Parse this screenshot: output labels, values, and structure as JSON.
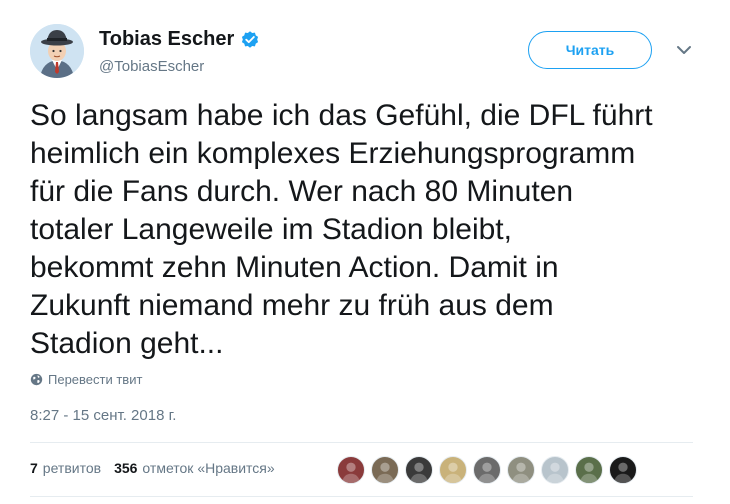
{
  "user": {
    "display_name": "Tobias Escher",
    "handle": "@TobiasEscher",
    "verified_icon": "verified-badge-icon",
    "avatar_icon": "avatar-man-with-hat"
  },
  "follow_button": {
    "label": "Читать"
  },
  "menu_caret_icon": "chevron-down-icon",
  "tweet": {
    "text": "So langsam habe ich das Gefühl, die DFL führt\nheimlich ein komplexes Erziehungsprogramm\nfür die Fans durch. Wer nach 80 Minuten\ntotaler Langeweile im Stadion bleibt,\nbekommt zehn Minuten Action. Damit in\nZukunft niemand mehr zu früh aus dem\nStadion geht..."
  },
  "translate": {
    "label": "Перевести твит",
    "icon": "globe-icon"
  },
  "timestamp": "8:27 - 15 сент. 2018 г.",
  "stats": {
    "retweets_count": "7",
    "retweets_label": "ретвитов",
    "likes_count": "356",
    "likes_label": "отметок «Нравится»"
  },
  "likers": [
    {
      "icon": "liker-avatar-1",
      "color": "#8a3b3b"
    },
    {
      "icon": "liker-avatar-2",
      "color": "#7a6a55"
    },
    {
      "icon": "liker-avatar-3",
      "color": "#3a3a3a"
    },
    {
      "icon": "liker-avatar-4",
      "color": "#c9b27a"
    },
    {
      "icon": "liker-avatar-5",
      "color": "#6b6b6b"
    },
    {
      "icon": "liker-avatar-6",
      "color": "#8f8f80"
    },
    {
      "icon": "liker-avatar-7",
      "color": "#b8c4cc"
    },
    {
      "icon": "liker-avatar-8",
      "color": "#5a6f4a"
    },
    {
      "icon": "liker-avatar-9",
      "color": "#1a1a1a"
    }
  ],
  "colors": {
    "accent": "#1da1f2",
    "text_primary": "#14171a",
    "text_secondary": "#657786",
    "divider": "#e6ecf0"
  }
}
